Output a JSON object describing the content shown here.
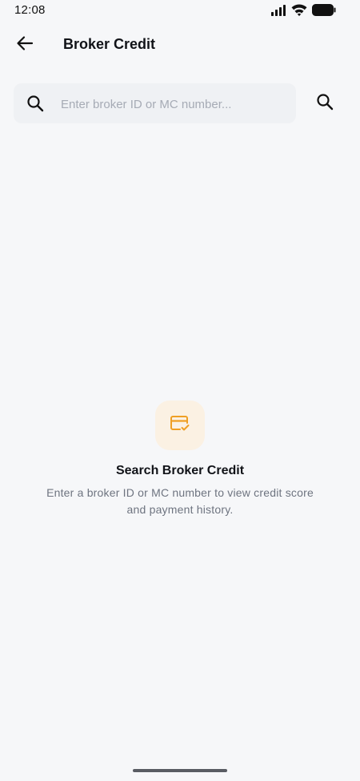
{
  "status_bar": {
    "time": "12:08",
    "icons": [
      "signal-icon",
      "wifi-icon",
      "battery-icon"
    ]
  },
  "header": {
    "back_icon": "arrow-left-icon",
    "title": "Broker Credit"
  },
  "search": {
    "icon": "search-icon",
    "value": "",
    "placeholder": "Enter broker ID or MC number...",
    "submit_icon": "search-icon"
  },
  "empty_state": {
    "icon": "credit-card-check-icon",
    "title": "Search Broker Credit",
    "description": "Enter a broker ID or MC number to view credit score and payment history."
  },
  "colors": {
    "background": "#f6f7f9",
    "search_field": "#eff1f4",
    "accent": "#ef9f24",
    "accent_soft": "#fbf1e3",
    "text_primary": "#111318",
    "text_secondary": "#6e7480"
  }
}
